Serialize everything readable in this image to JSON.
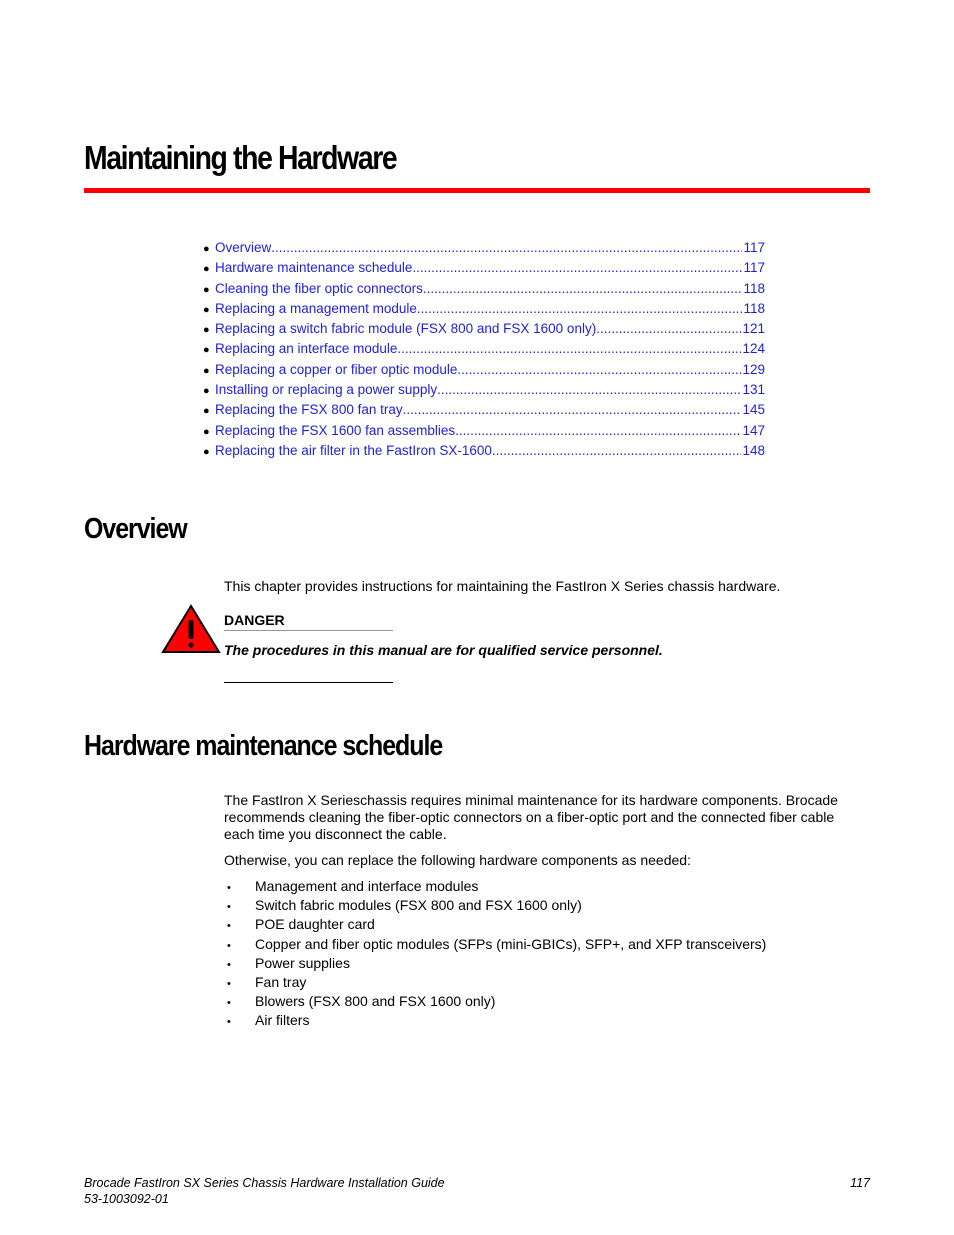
{
  "chapter": {
    "title": "Maintaining the Hardware"
  },
  "toc": {
    "bullet": "●",
    "items": [
      {
        "label": "Overview",
        "page": "117"
      },
      {
        "label": "Hardware maintenance schedule",
        "page": "117"
      },
      {
        "label": "Cleaning the fiber optic connectors",
        "page": "118"
      },
      {
        "label": "Replacing a management module",
        "page": "118"
      },
      {
        "label": "Replacing a switch fabric module (FSX 800 and FSX 1600 only)",
        "page": "121"
      },
      {
        "label": "Replacing an interface module",
        "page": "124"
      },
      {
        "label": "Replacing a copper or fiber optic module",
        "page": "129"
      },
      {
        "label": "Installing or replacing a power supply",
        "page": "131"
      },
      {
        "label": "Replacing the FSX 800 fan tray",
        "page": "145"
      },
      {
        "label": "Replacing the FSX 1600 fan assemblies",
        "page": "147"
      },
      {
        "label": "Replacing the air filter in the FastIron SX-1600",
        "page": "148"
      }
    ]
  },
  "overview": {
    "heading": "Overview",
    "paragraph": "This chapter provides instructions for maintaining the FastIron X Series chassis hardware.",
    "danger": {
      "icon": "warning-triangle-icon",
      "label": "DANGER",
      "text": "The procedures in this manual are for qualified service personnel."
    }
  },
  "schedule": {
    "heading": "Hardware maintenance schedule",
    "paragraph1": "The FastIron X Serieschassis requires minimal maintenance for its hardware components. Brocade recommends cleaning the fiber-optic connectors on a fiber-optic port and the connected fiber cable each time you disconnect the cable.",
    "paragraph2": "Otherwise, you can replace the following hardware components as needed:",
    "bullet": "•",
    "components": [
      "Management and interface modules",
      "Switch fabric modules (FSX 800 and FSX 1600 only)",
      "POE daughter card",
      "Copper and fiber optic modules (SFPs (mini-GBICs), SFP+, and XFP transceivers)",
      "Power supplies",
      "Fan tray",
      "Blowers (FSX 800 and FSX 1600 only)",
      "Air filters"
    ]
  },
  "footer": {
    "guide_title": "Brocade FastIron SX Series Chassis Hardware Installation Guide",
    "doc_number": "53-1003092-01",
    "page_number": "117"
  },
  "colors": {
    "accent_rule": "#ff0000",
    "link": "#1f1fd8",
    "danger_fill": "#ff0000"
  }
}
